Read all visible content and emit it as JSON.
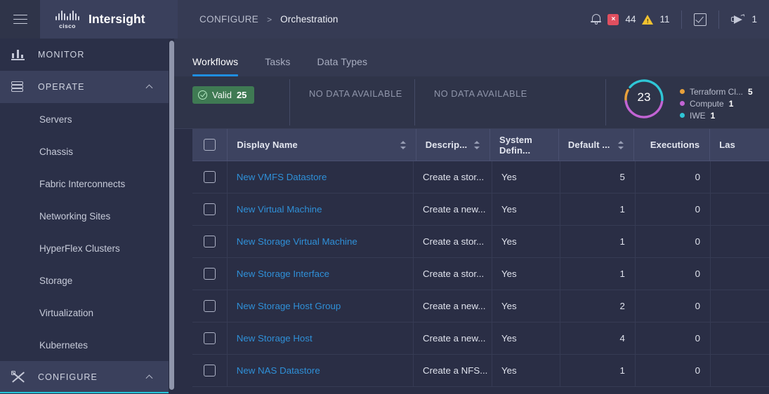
{
  "topbar": {
    "menu_icon": "hamburger-icon",
    "brand_logo": "cisco-logo",
    "brand_cisco": "cisco",
    "brand_name": "Intersight",
    "breadcrumb": {
      "root": "CONFIGURE",
      "separator": ">",
      "leaf": "Orchestration"
    },
    "alarms": {
      "bell_icon": "bell-icon",
      "critical_icon": "error-badge-icon",
      "critical_count": "44",
      "warning_icon": "warning-triangle-icon",
      "warning_count": "11"
    },
    "tasks_icon": "checklist-icon",
    "announcements": {
      "icon": "megaphone-icon",
      "count": "1"
    }
  },
  "sidebar": {
    "groups": [
      {
        "label": "MONITOR",
        "icon": "bar-chart-icon",
        "expanded": false,
        "children": []
      },
      {
        "label": "OPERATE",
        "icon": "layers-icon",
        "expanded": true,
        "children": [
          "Servers",
          "Chassis",
          "Fabric Interconnects",
          "Networking Sites",
          "HyperFlex Clusters",
          "Storage",
          "Virtualization",
          "Kubernetes"
        ]
      },
      {
        "label": "CONFIGURE",
        "icon": "tools-icon",
        "expanded": true,
        "children": []
      }
    ],
    "scrollbar": "sidebar-scrollbar"
  },
  "main": {
    "tabs": [
      {
        "label": "Workflows",
        "active": true
      },
      {
        "label": "Tasks",
        "active": false
      },
      {
        "label": "Data Types",
        "active": false
      }
    ],
    "summary": {
      "validity": {
        "status_label": "Valid",
        "status_count": "25",
        "icon": "check-circle-icon"
      },
      "no_data_1": "NO DATA AVAILABLE",
      "no_data_2": "NO DATA AVAILABLE"
    }
  },
  "chart_data": {
    "type": "pie",
    "title": "",
    "center_total": "23",
    "legend_position": "right",
    "categories": [
      "Terraform Cl...",
      "Compute",
      "IWE"
    ],
    "values": [
      5,
      1,
      1
    ],
    "colors": [
      "#e9a13b",
      "#c264d4",
      "#2fc6d6"
    ],
    "legend": [
      {
        "name": "Terraform Cl...",
        "value": "5",
        "color": "#e9a13b"
      },
      {
        "name": "Compute",
        "value": "1",
        "color": "#c264d4"
      },
      {
        "name": "IWE",
        "value": "1",
        "color": "#2fc6d6"
      }
    ]
  },
  "table": {
    "select_all_checkbox": "select-all",
    "columns": [
      {
        "key": "name",
        "label": "Display Name",
        "sortable": true,
        "align": "left"
      },
      {
        "key": "desc",
        "label": "Descrip...",
        "sortable": true,
        "align": "left"
      },
      {
        "key": "sys",
        "label": "System Defin...",
        "sortable": false,
        "align": "left"
      },
      {
        "key": "def",
        "label": "Default ...",
        "sortable": true,
        "align": "right"
      },
      {
        "key": "exec",
        "label": "Executions",
        "sortable": false,
        "align": "right"
      },
      {
        "key": "last",
        "label": "Las",
        "sortable": false,
        "align": "left"
      }
    ],
    "rows": [
      {
        "name": "New VMFS Datastore",
        "desc": "Create a stor...",
        "sys": "Yes",
        "def": "5",
        "exec": "0",
        "last": ""
      },
      {
        "name": "New Virtual Machine",
        "desc": "Create a new...",
        "sys": "Yes",
        "def": "1",
        "exec": "0",
        "last": ""
      },
      {
        "name": "New Storage Virtual Machine",
        "desc": "Create a stor...",
        "sys": "Yes",
        "def": "1",
        "exec": "0",
        "last": ""
      },
      {
        "name": "New Storage Interface",
        "desc": "Create a stor...",
        "sys": "Yes",
        "def": "1",
        "exec": "0",
        "last": ""
      },
      {
        "name": "New Storage Host Group",
        "desc": "Create a new...",
        "sys": "Yes",
        "def": "2",
        "exec": "0",
        "last": ""
      },
      {
        "name": "New Storage Host",
        "desc": "Create a new...",
        "sys": "Yes",
        "def": "4",
        "exec": "0",
        "last": ""
      },
      {
        "name": "New NAS Datastore",
        "desc": "Create a NFS...",
        "sys": "Yes",
        "def": "1",
        "exec": "0",
        "last": ""
      }
    ]
  },
  "colors": {
    "accent_tab": "#1f8ee0",
    "link": "#2f90d8",
    "valid_green": "#3f7a53",
    "critical_red": "#e04f5f",
    "warning_yellow": "#f2c230",
    "nav_accent": "#26c6da"
  }
}
